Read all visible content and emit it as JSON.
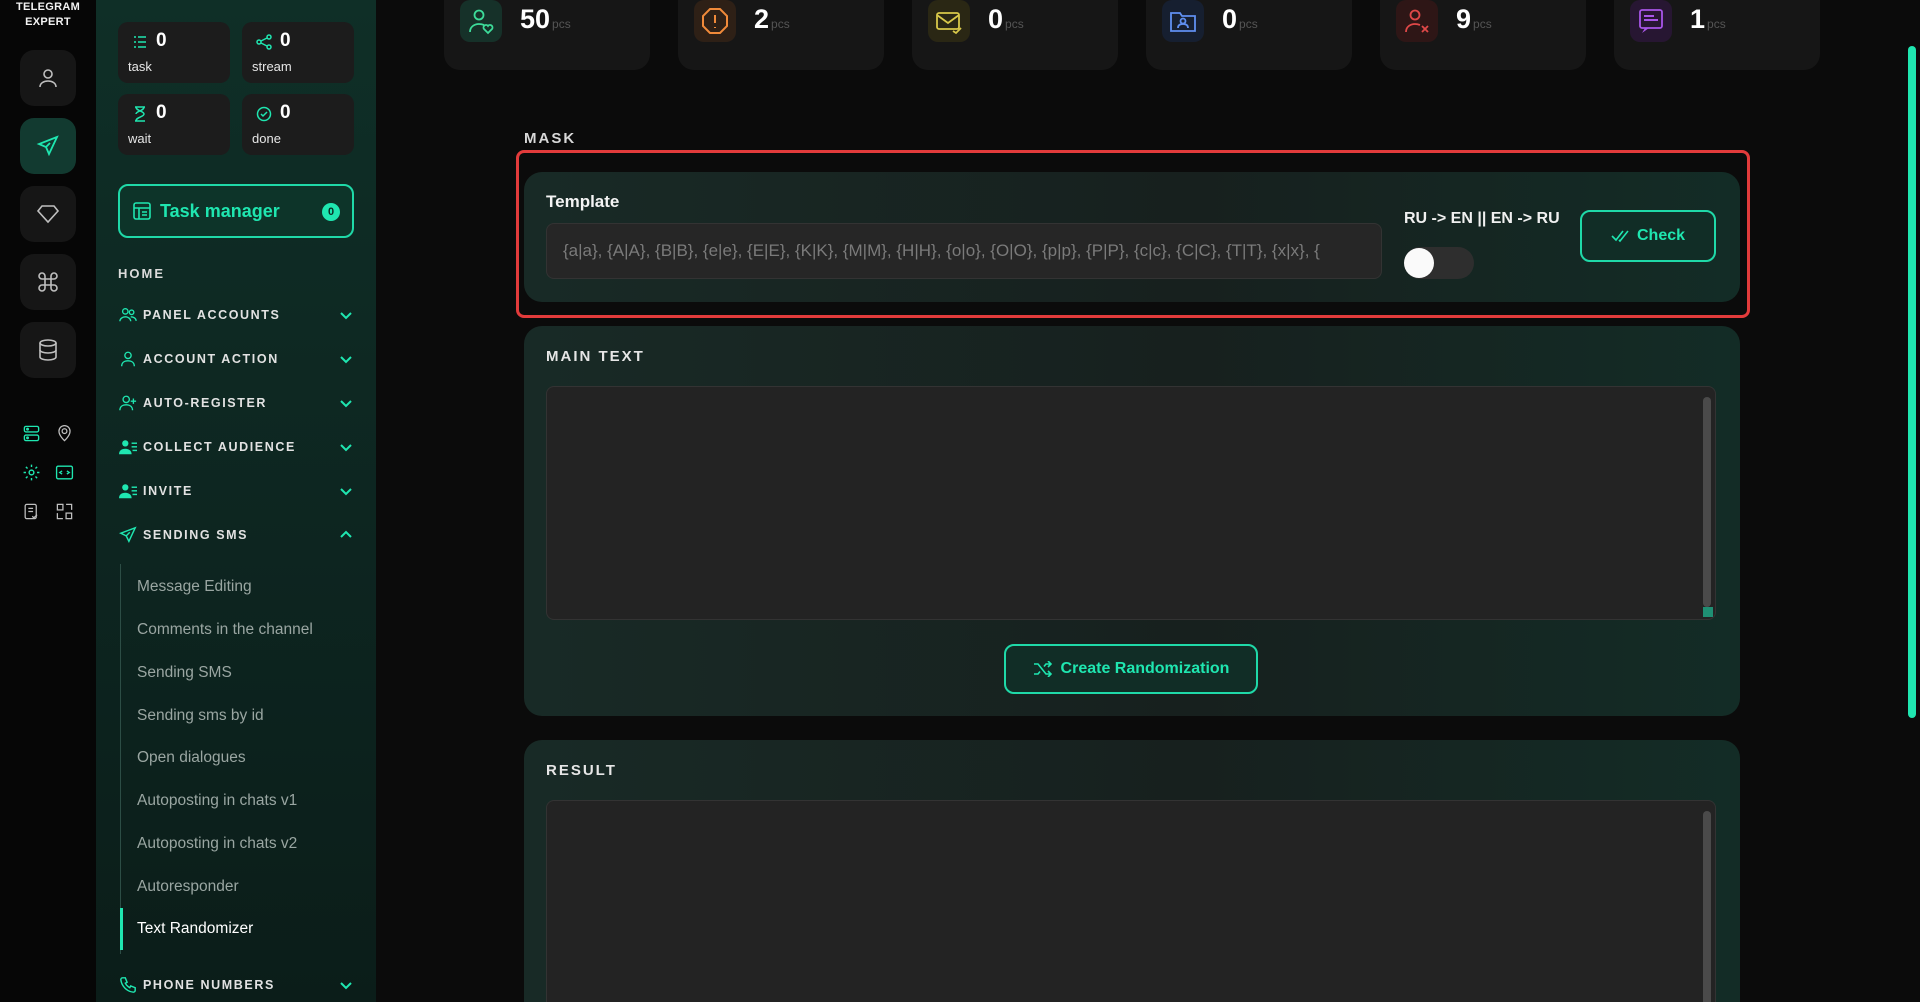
{
  "app": {
    "logo_line1": "TELEGRAM",
    "logo_line2": "EXPERT"
  },
  "rail": {
    "buttons": [
      "user-icon",
      "send-icon",
      "diamond-icon",
      "command-icon",
      "database-icon"
    ],
    "mini": [
      "server-icon",
      "location-icon",
      "settings-icon",
      "code-icon",
      "document-check-icon",
      "scan-icon"
    ]
  },
  "stats": {
    "task": {
      "value": "0",
      "label": "task"
    },
    "stream": {
      "value": "0",
      "label": "stream"
    },
    "wait": {
      "value": "0",
      "label": "wait"
    },
    "done": {
      "value": "0",
      "label": "done"
    }
  },
  "task_manager": {
    "label": "Task manager",
    "count": "0"
  },
  "nav": {
    "home": "HOME",
    "items": [
      {
        "label": "PANEL ACCOUNTS"
      },
      {
        "label": "ACCOUNT ACTION"
      },
      {
        "label": "AUTO-REGISTER"
      },
      {
        "label": "COLLECT AUDIENCE"
      },
      {
        "label": "INVITE"
      },
      {
        "label": "SENDING SMS"
      },
      {
        "label": "PHONE NUMBERS"
      }
    ],
    "sub_items": [
      "Message Editing",
      "Comments in the channel",
      "Sending SMS",
      "Sending sms by id",
      "Open dialogues",
      "Autoposting in chats v1",
      "Autoposting in chats v2",
      "Autoresponder",
      "Text Randomizer"
    ]
  },
  "top_stats": [
    {
      "value": "50",
      "unit": "pcs",
      "icon": "user-heart-icon",
      "color": "#3ddc9a"
    },
    {
      "value": "2",
      "unit": "pcs",
      "icon": "warning-octagon-icon",
      "color": "#f08a3a"
    },
    {
      "value": "0",
      "unit": "pcs",
      "icon": "mail-icon",
      "color": "#d8c84a"
    },
    {
      "value": "0",
      "unit": "pcs",
      "icon": "folder-user-icon",
      "color": "#5f8ff0"
    },
    {
      "value": "9",
      "unit": "pcs",
      "icon": "user-x-icon",
      "color": "#e04848"
    },
    {
      "value": "1",
      "unit": "pcs",
      "icon": "chat-list-icon",
      "color": "#a855e8"
    }
  ],
  "mask": {
    "section_label": "MASK",
    "template_title": "Template",
    "template_placeholder": "{a|a}, {A|A}, {B|B}, {e|e}, {E|E}, {K|K}, {M|M}, {H|H}, {o|o}, {O|O}, {p|p}, {P|P}, {c|c}, {C|C}, {T|T}, {x|x}, {",
    "lang_label": "RU -> EN || EN -> RU",
    "check_label": "Check"
  },
  "main_text": {
    "title": "MAIN TEXT",
    "value": "",
    "button_label": "Create Randomization"
  },
  "result": {
    "title": "RESULT",
    "value": ""
  },
  "colors": {
    "accent": "#1fe6b0",
    "highlight": "#e23b3b"
  }
}
